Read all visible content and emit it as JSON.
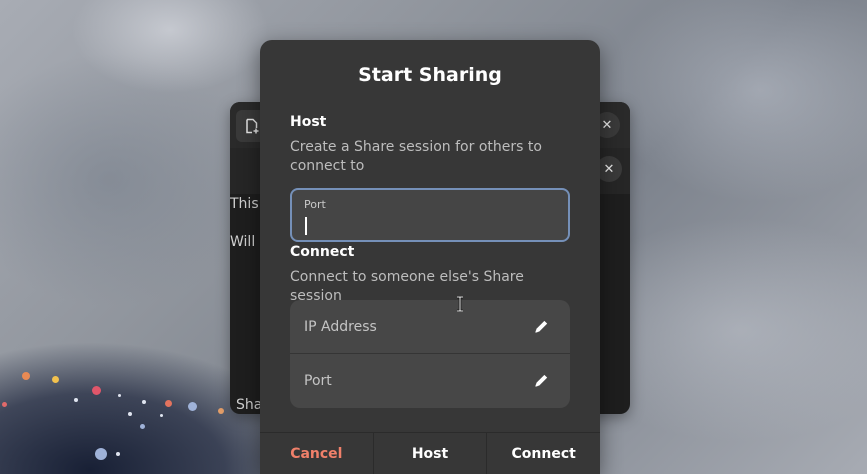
{
  "dialog": {
    "title": "Start Sharing",
    "host_section": {
      "title": "Host",
      "description": "Create a Share session for others to connect to",
      "port_field": {
        "label": "Port",
        "value": ""
      }
    },
    "connect_section": {
      "title": "Connect",
      "description": "Connect to someone else's Share session",
      "rows": [
        {
          "label": "IP Address",
          "icon": "pencil-icon"
        },
        {
          "label": "Port",
          "icon": "pencil-icon"
        }
      ]
    },
    "buttons": {
      "cancel": "Cancel",
      "host": "Host",
      "connect": "Connect"
    }
  },
  "background_window": {
    "text_line_1": "This",
    "text_line_2": "Will",
    "footer_text": "Sha"
  },
  "colors": {
    "dialog_bg": "#373737",
    "focus_ring": "#7590b8",
    "destructive": "#f0806a",
    "list_bg": "#474747"
  }
}
